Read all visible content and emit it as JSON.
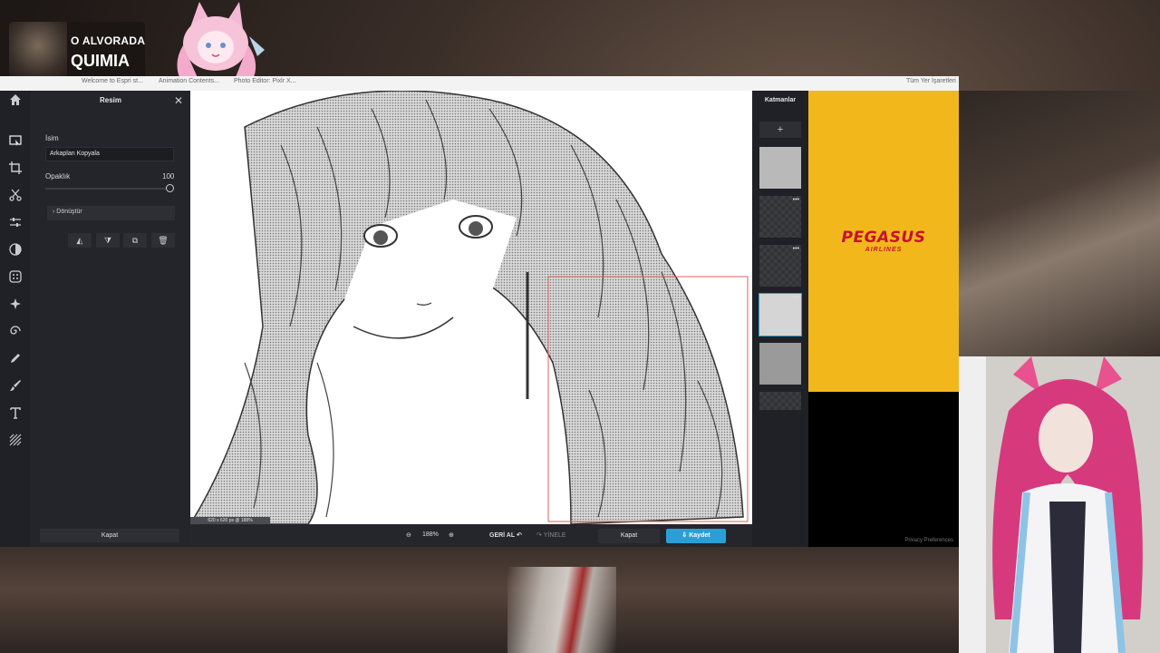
{
  "overlay": {
    "title": "O ALVORADA",
    "subtitle": "QUIMIA"
  },
  "browser": {
    "tabs": [
      "Welcome to Espri st...",
      "Animation Contents...",
      "Photo Editor: Pixlr X...",
      "Tüm Yer İşaretleri"
    ]
  },
  "sidebar": {
    "tools": [
      "home-icon",
      "arrange-icon",
      "crop-icon",
      "cutout-icon",
      "adjust-icon",
      "filter-icon",
      "effect-icon",
      "retouch-icon",
      "liquify-icon",
      "draw-icon",
      "brush-icon",
      "text-icon",
      "pattern-icon"
    ]
  },
  "panel": {
    "title": "Resim",
    "name_label": "İsim",
    "name_value": "Arkaplan Kopyala",
    "opacity_label": "Opaklık",
    "opacity_value": "100",
    "transform_label": "Dönüştür",
    "close_label": "Kapat"
  },
  "canvas": {
    "info": "620 x 620 px @ 188%"
  },
  "bottom": {
    "zoom": "188%",
    "undo": "GERİ AL",
    "redo": "YİNELE",
    "close": "Kapat",
    "save": "Kaydet"
  },
  "layers": {
    "title": "Katmanlar",
    "add": "+"
  },
  "ad": {
    "brand": "PEGASUS",
    "sub": "AIRLINES",
    "privacy": "Privacy Preferences"
  },
  "colors": {
    "accent": "#2a9fd6",
    "ad_bg": "#f2b81b",
    "ad_text": "#c8102e"
  }
}
